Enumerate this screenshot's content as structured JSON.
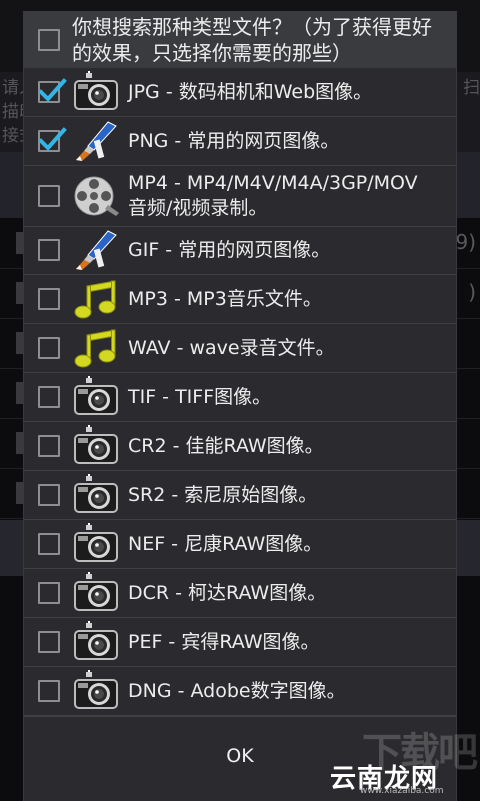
{
  "background": {
    "text_fragments": [
      "请人",
      "描印",
      "接式"
    ],
    "right_fragments": [
      "扫"
    ],
    "row_right_values": [
      "9)",
      ")"
    ]
  },
  "dialog": {
    "header": {
      "title": "你想搜索那种类型文件？（为了获得更好\n的效果，只选择你需要的那些）",
      "select_all_checked": false
    },
    "items": [
      {
        "label": "JPG - 数码相机和Web图像。",
        "checked": true,
        "icon": "camera-icon"
      },
      {
        "label": "PNG - 常用的网页图像。",
        "checked": true,
        "icon": "paint-brush-icon"
      },
      {
        "label": "MP4 - MP4/M4V/M4A/3GP/MOV\n音频/视频录制。",
        "checked": false,
        "icon": "film-reel-icon"
      },
      {
        "label": "GIF - 常用的网页图像。",
        "checked": false,
        "icon": "paint-brush-icon"
      },
      {
        "label": "MP3 - MP3音乐文件。",
        "checked": false,
        "icon": "music-note-icon"
      },
      {
        "label": "WAV - wave录音文件。",
        "checked": false,
        "icon": "music-note-icon"
      },
      {
        "label": "TIF - TIFF图像。",
        "checked": false,
        "icon": "camera-icon"
      },
      {
        "label": "CR2 - 佳能RAW图像。",
        "checked": false,
        "icon": "camera-icon"
      },
      {
        "label": "SR2 - 索尼原始图像。",
        "checked": false,
        "icon": "camera-icon"
      },
      {
        "label": "NEF - 尼康RAW图像。",
        "checked": false,
        "icon": "camera-icon"
      },
      {
        "label": "DCR - 柯达RAW图像。",
        "checked": false,
        "icon": "camera-icon"
      },
      {
        "label": "PEF - 宾得RAW图像。",
        "checked": false,
        "icon": "camera-icon"
      },
      {
        "label": "DNG - Adobe数字图像。",
        "checked": false,
        "icon": "camera-icon"
      }
    ],
    "ok_label": "OK"
  },
  "watermark": {
    "text": "云南龙网",
    "url": "www.xiazaiba.com",
    "big": "下载吧"
  },
  "colors": {
    "check_blue": "#33b5e5",
    "dialog_bg": "#2b2b2f",
    "header_bg": "#3a3b3f",
    "note_yellow": "#d4d81e"
  }
}
